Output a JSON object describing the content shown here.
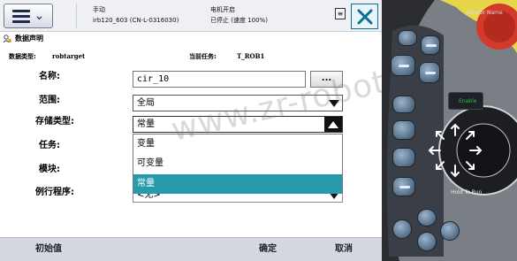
{
  "topbar": {
    "mode_label": "手动",
    "system_name": "irb120_603 (CN-L-0316030)",
    "motor_status": "电机开启",
    "run_status": "已停止 (速度 100%)"
  },
  "window": {
    "title": "数据声明"
  },
  "info": {
    "type_label": "数据类型:",
    "type_value": "robtarget",
    "task_label": "当前任务:",
    "task_value": "T_ROB1"
  },
  "form": {
    "name_label": "名称:",
    "name_value": "cir_10",
    "name_button": "...",
    "scope_label": "范围:",
    "scope_value": "全局",
    "storage_label": "存储类型:",
    "storage_value": "常量",
    "task_label": "任务:",
    "module_label": "模块:",
    "routine_label": "例行程序:",
    "routine_value": "<无>"
  },
  "dropdown": {
    "options": [
      "变量",
      "可变量",
      "常量"
    ],
    "selected_index": 2
  },
  "bottombar": {
    "init_label": "初始值",
    "ok_label": "确定",
    "cancel_label": "取消"
  },
  "watermark": "www.zr-robot.com",
  "pendant": {
    "vendor_name": "Vendor Name",
    "enable_label": "Enable",
    "hold_to_run_label": "Hold To Run"
  },
  "colors": {
    "selected_option_bg": "#279bac",
    "close_button_border": "#0f6d8e",
    "pendant_body": "#2b2d31",
    "enable_text": "#22c24a"
  },
  "icons": {
    "menu": "hamburger-menu-icon",
    "menu_chevron": "chevron-down-icon",
    "program": "program-document-icon",
    "close": "close-icon",
    "title": "data-declaration-icon",
    "dropdown": "triangle-down-icon",
    "dropdown_open": "triangle-up-icon"
  }
}
